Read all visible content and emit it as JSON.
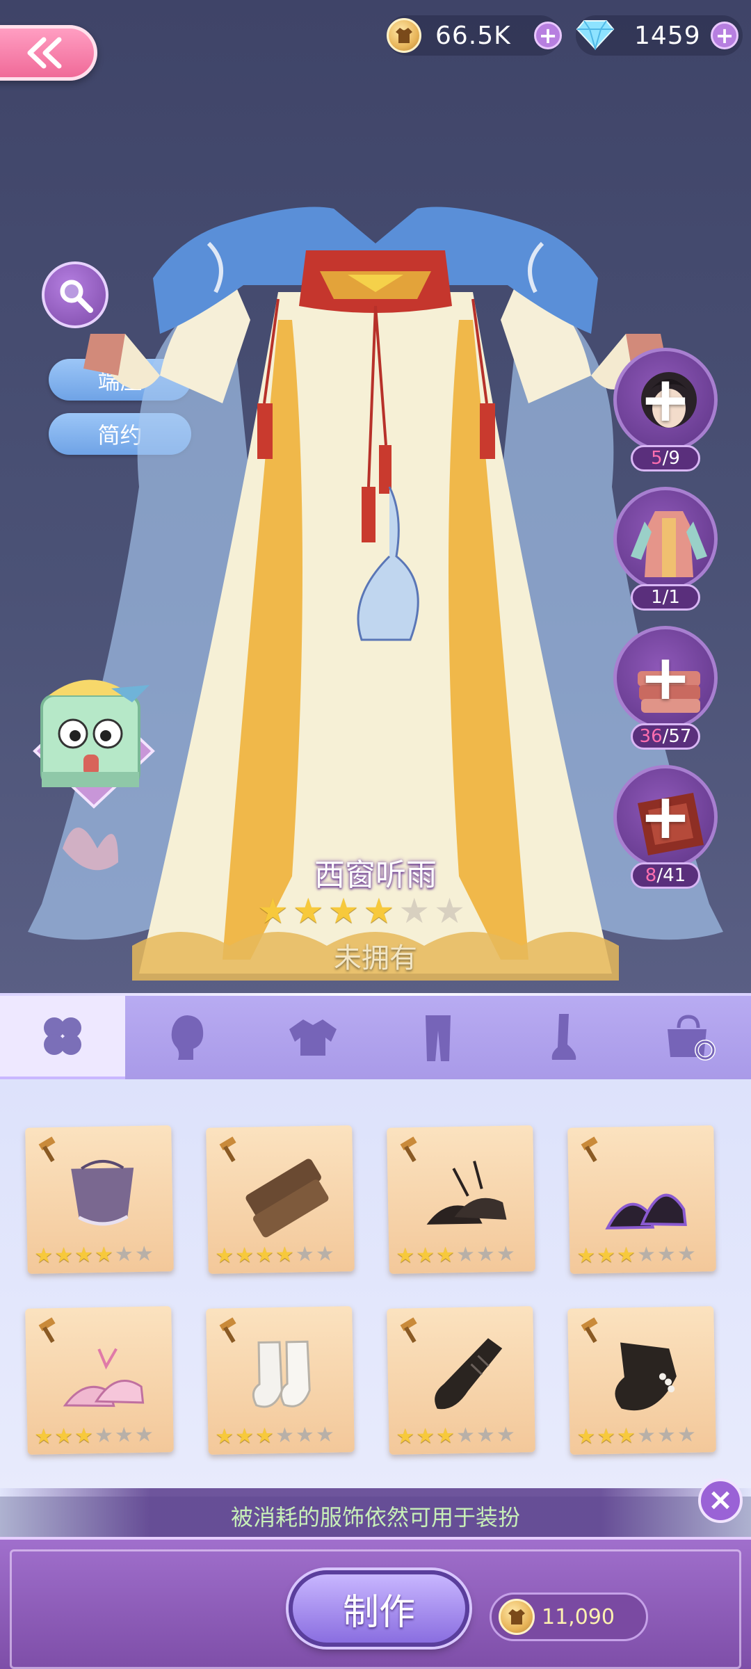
{
  "topbar": {
    "coins": "66.5K",
    "diamonds": "1459"
  },
  "tags": [
    "端庄",
    "简约"
  ],
  "slots": [
    {
      "name": "hair",
      "owned": "5",
      "total": "/9"
    },
    {
      "name": "outfit",
      "owned": "1",
      "total": "/1"
    },
    {
      "name": "fabric",
      "owned": "36",
      "total": "/57"
    },
    {
      "name": "leather",
      "owned": "8",
      "total": "/41"
    }
  ],
  "outfit": {
    "name": "西窗听雨",
    "stars": 4,
    "max_stars": 6,
    "status": "未拥有"
  },
  "tabs": [
    "accessory",
    "hair",
    "top",
    "bottom",
    "shoes",
    "bag"
  ],
  "items": [
    {
      "icon": "top-icon",
      "stars": 4
    },
    {
      "icon": "wood-plank-icon",
      "stars": 4
    },
    {
      "icon": "black-heels-icon",
      "stars": 3
    },
    {
      "icon": "purple-heels-icon",
      "stars": 3
    },
    {
      "icon": "pink-heels-icon",
      "stars": 3
    },
    {
      "icon": "white-gloves-icon",
      "stars": 3
    },
    {
      "icon": "black-lace-glove-icon",
      "stars": 3
    },
    {
      "icon": "black-pearl-glove-icon",
      "stars": 3
    }
  ],
  "banner_text": "被消耗的服饰依然可用于装扮",
  "make_label": "制作",
  "cost": "11,090",
  "colors": {
    "accent_pink": "#f06a98",
    "tab_bg": "#b8abf2",
    "panel_purple": "#8e5ebb",
    "star_gold": "#f7c93c"
  }
}
